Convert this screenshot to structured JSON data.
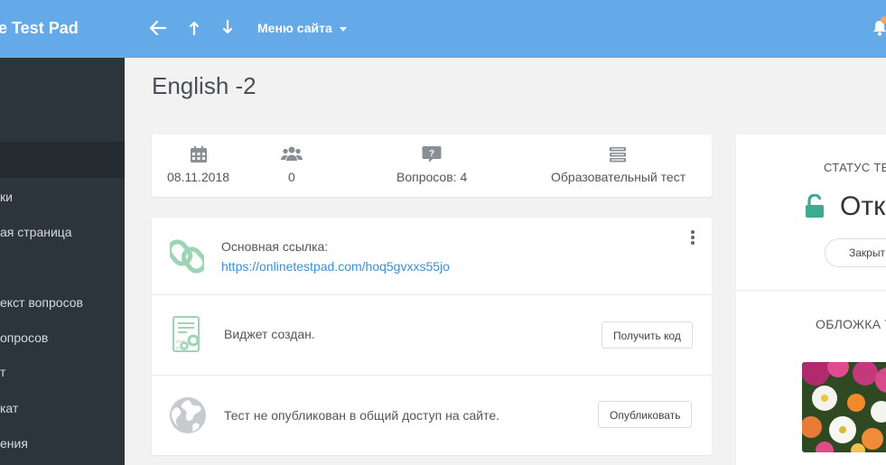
{
  "topbar": {
    "brand": "e Test Pad",
    "site_menu_label": "Меню сайта"
  },
  "sidebar": {
    "items": [
      {
        "label": "ки"
      },
      {
        "label": "ая страница"
      },
      {
        "label": "екст вопросов"
      },
      {
        "label": "опросов"
      },
      {
        "label": "т"
      },
      {
        "label": "кат"
      },
      {
        "label": "ения"
      }
    ]
  },
  "page": {
    "title": "English -2"
  },
  "stats": {
    "date": "08.11.2018",
    "participants": "0",
    "questions": "Вопросов: 4",
    "test_type": "Образовательный тест"
  },
  "publish": {
    "main_link_label": "Основная ссылка:",
    "main_link_url": "https://onlinetestpad.com/hoq5gvxxs55jo",
    "widget_text": "Виджет создан.",
    "get_code_button": "Получить код",
    "public_text": "Тест не опубликован в общий доступ на сайте.",
    "publish_button": "Опубликовать"
  },
  "status_panel": {
    "status_label": "СТАТУС ТЕ",
    "status_value": "Отк",
    "close_button": "Закрыт",
    "cover_label": "ОБЛОЖКА Т"
  },
  "colors": {
    "topbar": "#64a9e8",
    "sidebar": "#2d353c",
    "accent_green": "#3cab8f",
    "link": "#3d8fd6"
  }
}
